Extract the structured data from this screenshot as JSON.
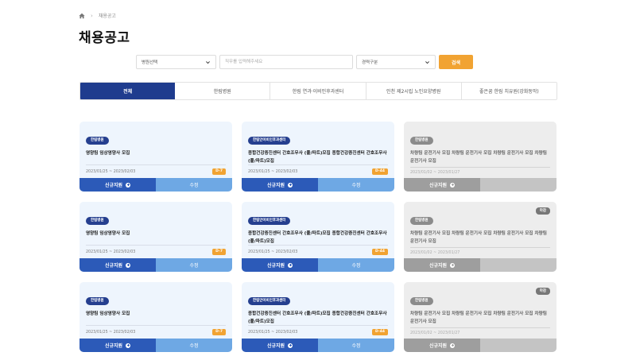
{
  "breadcrumb": {
    "current": "채용공고"
  },
  "page": {
    "title": "채용공고"
  },
  "filters": {
    "hospital_select": "병원선택",
    "search_placeholder": "직무를 입력해주세요",
    "career_select": "경력구분",
    "search_button": "검색"
  },
  "tabs": [
    {
      "label": "전체",
      "active": true
    },
    {
      "label": "한림병원",
      "active": false
    },
    {
      "label": "한림 연과·이비인후과센터",
      "active": false
    },
    {
      "label": "인천 제2시립 노인요양병원",
      "active": false
    },
    {
      "label": "좋은꿈 한림 치유원(강화동막)",
      "active": false
    }
  ],
  "cards": [
    {
      "badge": "한림병원",
      "title": "영양팀 임상영양사 모집",
      "date": "2023/01/25 ~ 2023/02/03",
      "dday": "D-7",
      "closed": false,
      "deadline_tag": "",
      "apply": "신규지원",
      "edit": "수정"
    },
    {
      "badge": "한림안이비인후과센터",
      "title": "종합건강증진센터 간호조무사 (풀/파트)모집 종합건강증진센터 간호조무사 (풀/파트)모집",
      "date": "2023/01/25 ~ 2023/02/03",
      "dday": "D-44",
      "closed": false,
      "deadline_tag": "",
      "apply": "신규지원",
      "edit": "수정"
    },
    {
      "badge": "한림병원",
      "title": "차량팀 운전기사 모집 차량팀 운전기사 모집 차량팀 운전기사 모집 차량팀 운전기사 모집",
      "date": "2023/01/02 ~ 2023/01/27",
      "dday": "",
      "closed": true,
      "deadline_tag": "",
      "apply": "신규지원",
      "edit": ""
    },
    {
      "badge": "한림병원",
      "title": "영양팀 임상영양사 모집",
      "date": "2023/01/25 ~ 2023/02/03",
      "dday": "D-7",
      "closed": false,
      "deadline_tag": "",
      "apply": "신규지원",
      "edit": "수정"
    },
    {
      "badge": "한림안이비인후과센터",
      "title": "종합건강증진센터 간호조무사 (풀/파트)모집 종합건강증진센터 간호조무사 (풀/파트)모집",
      "date": "2023/01/25 ~ 2023/02/03",
      "dday": "D-44",
      "closed": false,
      "deadline_tag": "",
      "apply": "신규지원",
      "edit": "수정"
    },
    {
      "badge": "한림병원",
      "title": "차량팀 운전기사 모집 차량팀 운전기사 모집 차량팀 운전기사 모집 차량팀 운전기사 모집",
      "date": "2023/01/02 ~ 2023/01/27",
      "dday": "",
      "closed": true,
      "deadline_tag": "마감",
      "apply": "신규지원",
      "edit": ""
    },
    {
      "badge": "한림병원",
      "title": "영양팀 임상영양사 모집",
      "date": "2023/01/25 ~ 2023/02/03",
      "dday": "D-7",
      "closed": false,
      "deadline_tag": "",
      "apply": "신규지원",
      "edit": "수정"
    },
    {
      "badge": "한림안이비인후과센터",
      "title": "종합건강증진센터 간호조무사 (풀/파트)모집 종합건강증진센터 간호조무사 (풀/파트)모집",
      "date": "2023/01/25 ~ 2023/02/03",
      "dday": "D-44",
      "closed": false,
      "deadline_tag": "",
      "apply": "신규지원",
      "edit": "수정"
    },
    {
      "badge": "한림병원",
      "title": "차량팀 운전기사 모집 차량팀 운전기사 모집 차량팀 운전기사 모집 차량팀 운전기사 모집",
      "date": "2023/01/02 ~ 2023/01/27",
      "dday": "",
      "closed": true,
      "deadline_tag": "마감",
      "apply": "신규지원",
      "edit": ""
    }
  ],
  "colors": {
    "primary": "#1f3c8e",
    "accent": "#f1a332",
    "apply": "#2c5ab8",
    "edit": "#6ea8e4"
  },
  "icons": {
    "home": "home-icon",
    "chevron": "chevron-down-icon",
    "plus": "plus-circle-icon"
  }
}
